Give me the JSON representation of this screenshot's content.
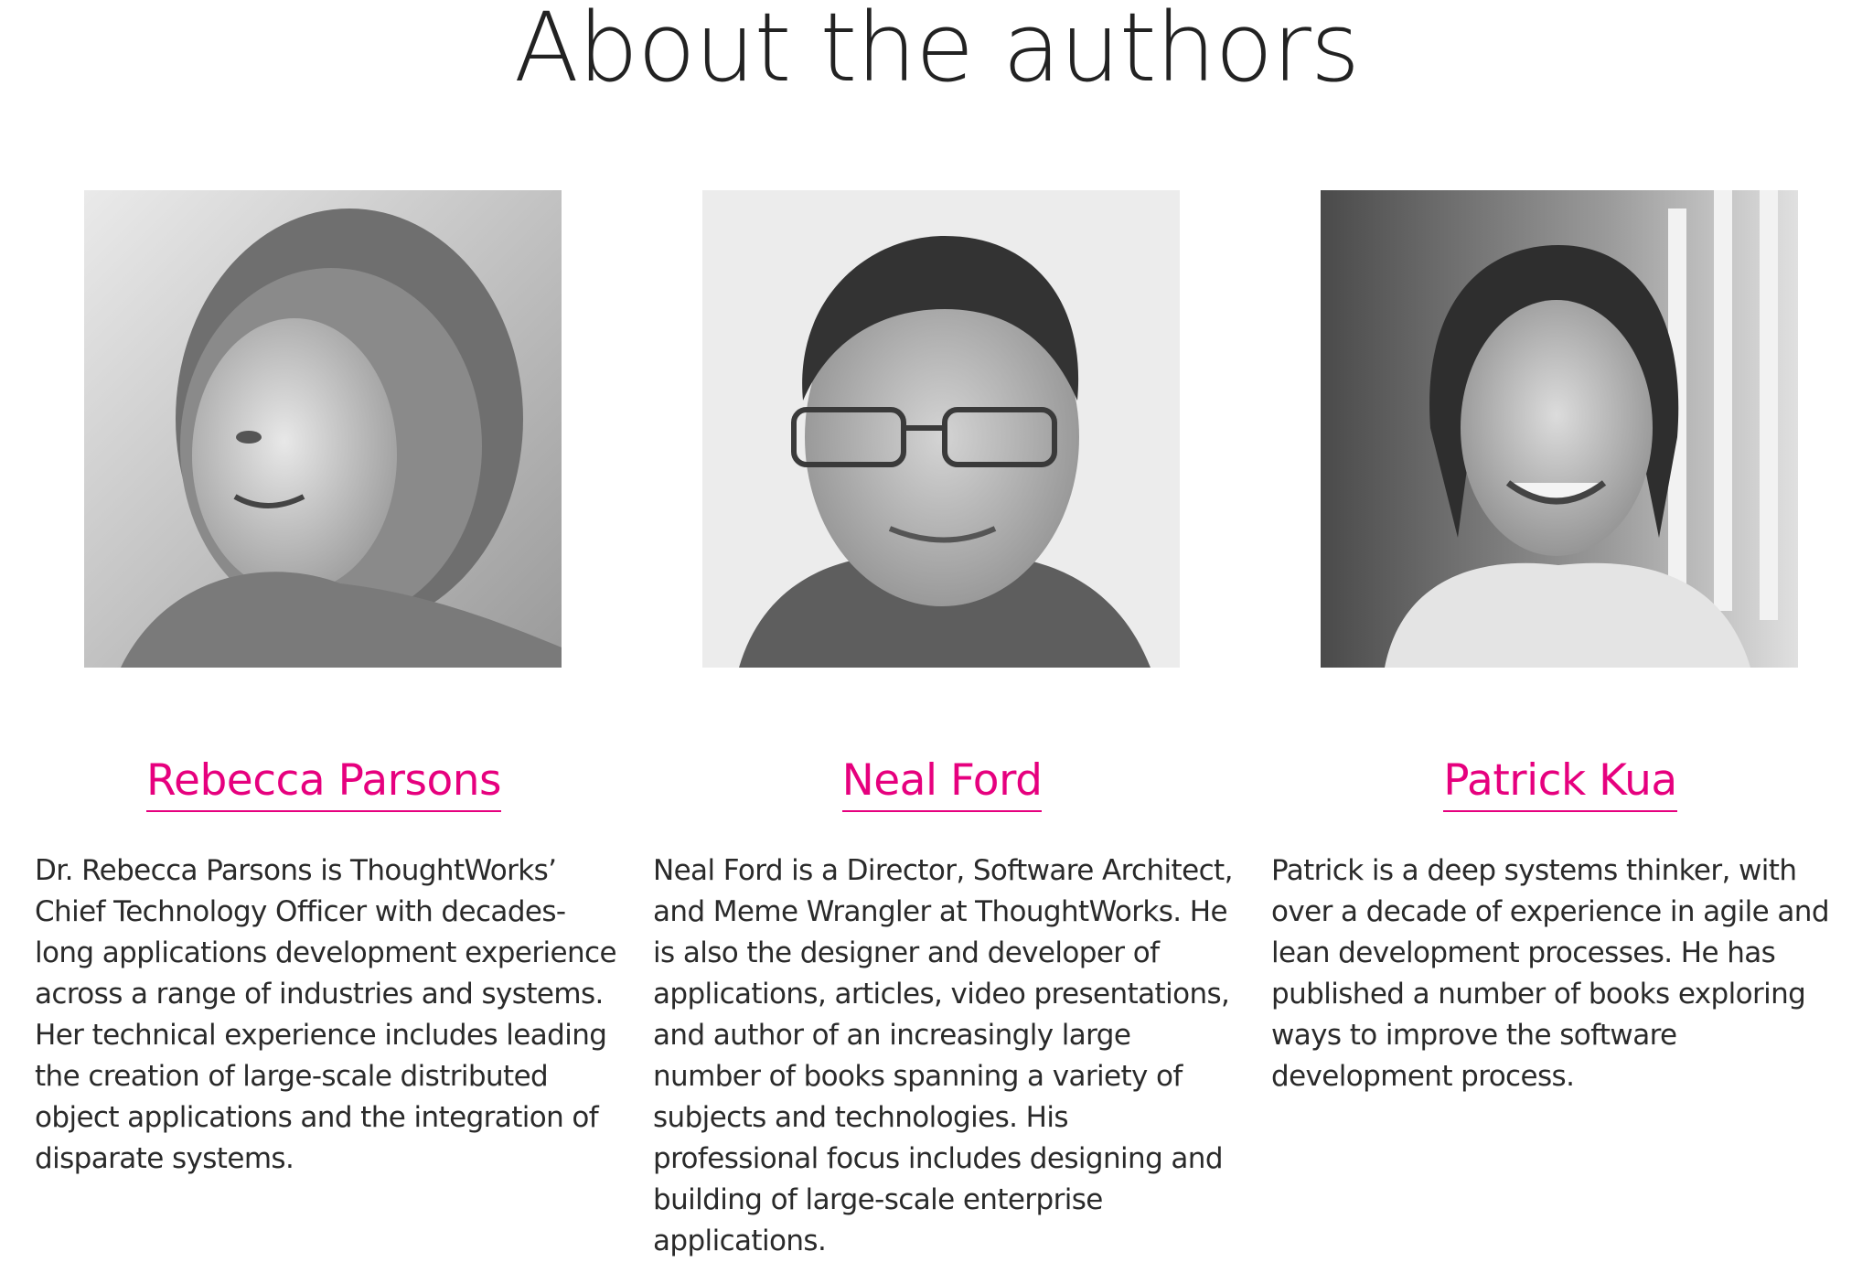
{
  "page": {
    "title": "About the authors"
  },
  "authors": [
    {
      "name": "Rebecca Parsons",
      "photo_icon": "portrait-photo-rebecca-parsons",
      "bio": "Dr. Rebecca Parsons is ThoughtWorks’ Chief Technology Officer with decades-long applications development experience across a range of industries and systems. Her technical experience includes leading the creation of large-scale distributed object applications and the integration of disparate systems."
    },
    {
      "name": "Neal Ford",
      "photo_icon": "portrait-photo-neal-ford",
      "bio": "Neal Ford is a Director, Software Architect, and Meme Wrangler at ThoughtWorks. He is also the designer and developer of applications, articles, video presentations, and author of an increasingly large number of books spanning a variety of subjects and technologies. His professional focus includes designing and building of large-scale enterprise applications."
    },
    {
      "name": "Patrick Kua",
      "photo_icon": "portrait-photo-patrick-kua",
      "bio": "Patrick is a deep systems thinker, with over a decade of experience in agile and lean development processes. He has published a number of books exploring ways to improve the software development process."
    }
  ],
  "colors": {
    "accent": "#e6007e",
    "text": "#222222",
    "background": "#ffffff"
  }
}
